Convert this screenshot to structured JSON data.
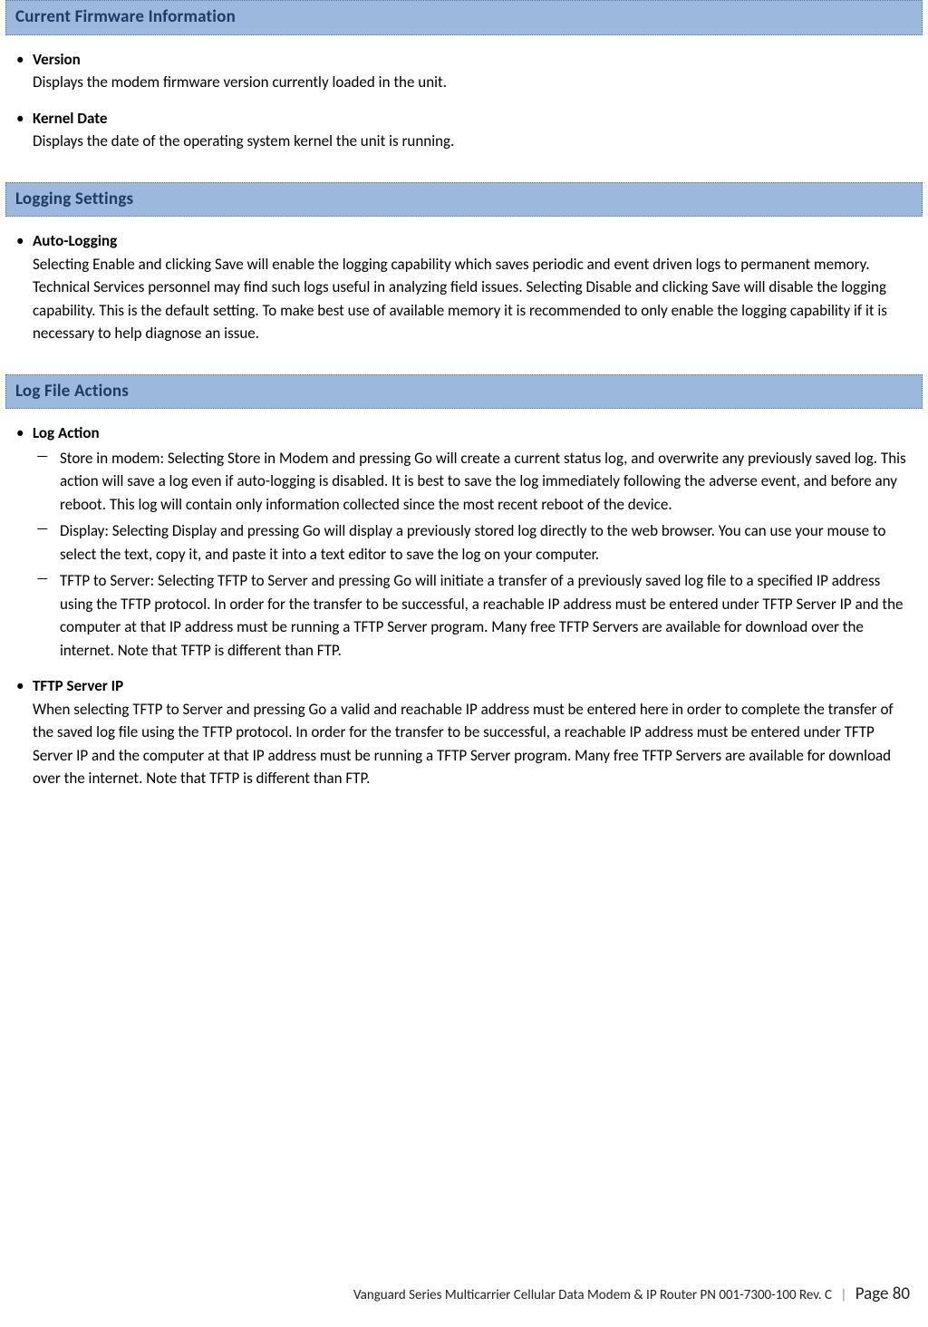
{
  "sections": {
    "firmware": {
      "header": "Current Firmware Information",
      "items": [
        {
          "term": "Version",
          "desc": "Displays the modem firmware version currently loaded in the unit."
        },
        {
          "term": "Kernel Date",
          "desc": "Displays the date of the operating system kernel the unit is running."
        }
      ]
    },
    "logging": {
      "header": "Logging Settings",
      "items": [
        {
          "term": "Auto-Logging",
          "desc": "Selecting Enable and clicking Save will enable the logging capability which saves periodic and event driven logs to permanent memory. Technical Services personnel may find such logs useful in analyzing field issues. Selecting Disable and clicking Save will disable the logging capability. This is the default setting. To make best use of available memory it is recommended to only enable the logging capability if it is necessary to help diagnose an issue."
        }
      ]
    },
    "logactions": {
      "header": "Log File Actions",
      "items": [
        {
          "term": "Log Action",
          "subs": [
            "Store in modem: Selecting Store in Modem and pressing Go will create a current status log, and overwrite any previously saved log. This action will save a log even if auto-logging is disabled. It is best to save the log immediately following the adverse event, and before any reboot. This log will contain only information collected since the most recent reboot of the device.",
            "Display: Selecting Display and pressing Go will display a previously stored log directly to the web browser. You can use your mouse to select the text, copy it, and paste it into a text editor to save the log on your computer.",
            "TFTP to Server: Selecting TFTP to Server and pressing Go will initiate a transfer of a previously saved log file to a specified IP address using the TFTP protocol. In order for the transfer to be successful, a reachable IP address must be entered under TFTP Server IP and the computer at that IP address must be running a TFTP Server program. Many free TFTP Servers are available for download over the internet. Note that TFTP is different than FTP."
          ]
        },
        {
          "term": "TFTP Server IP",
          "desc": "When selecting TFTP to Server and pressing Go a valid and reachable IP address must be entered here in order to complete the transfer of the saved log file using the TFTP protocol. In order for the transfer to be successful, a reachable IP address must be entered under TFTP Server IP and the computer at that IP address must be running a TFTP Server program. Many free TFTP Servers are available for download over the internet. Note that TFTP is different than FTP."
        }
      ]
    }
  },
  "footer": {
    "doc": "Vanguard Series Multicarrier Cellular Data Modem & IP Router PN 001-7300-100 Rev. C",
    "page_label": "Page 80"
  }
}
